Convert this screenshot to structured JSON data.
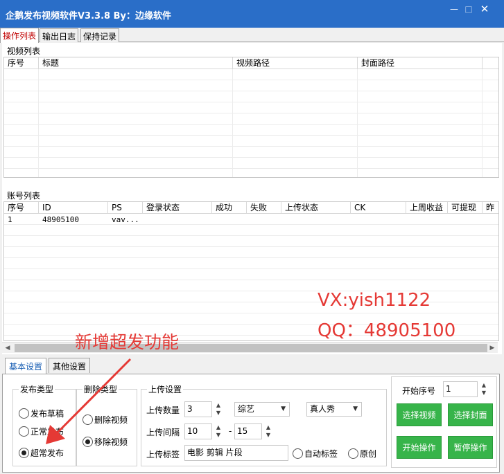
{
  "window": {
    "title": "企鹅发布视频软件V3.3.8 By：边缘软件",
    "min": "—",
    "max": "□",
    "close": "✕"
  },
  "main_tabs": [
    {
      "label": "操作列表"
    },
    {
      "label": "输出日志"
    },
    {
      "label": "保持记录"
    }
  ],
  "video_list": {
    "label": "视频列表",
    "columns": [
      "序号",
      "标题",
      "视频路径",
      "封面路径"
    ]
  },
  "account_list": {
    "label": "账号列表",
    "columns": [
      "序号",
      "ID",
      "PS",
      "登录状态",
      "成功",
      "失败",
      "上传状态",
      "CK",
      "上周收益",
      "可提现",
      "昨"
    ],
    "rows": [
      {
        "index": "1",
        "id": "48905100",
        "ps": "vav..."
      }
    ]
  },
  "overlay": {
    "promo": "新增超发功能",
    "vx": "VX:yish1122",
    "qq": "QQ：48905100"
  },
  "sub_tabs": [
    {
      "label": "基本设置"
    },
    {
      "label": "其他设置"
    }
  ],
  "publish_type": {
    "label": "发布类型",
    "options": [
      "发布草稿",
      "正常发布",
      "超常发布"
    ],
    "selected": 2
  },
  "delete_type": {
    "label": "删除类型",
    "options": [
      "删除视频",
      "移除视频"
    ],
    "selected": 1
  },
  "upload_settings": {
    "label": "上传设置",
    "count_label": "上传数量",
    "count_value": "3",
    "category_value": "综艺",
    "subcategory_value": "真人秀",
    "interval_label": "上传间隔",
    "interval_min": "10",
    "interval_sep": "-",
    "interval_max": "15",
    "tags_label": "上传标签",
    "tags_value": "电影 剪辑 片段",
    "auto_tag_label": "自动标签",
    "original_label": "原创"
  },
  "right_panel": {
    "start_index_label": "开始序号",
    "start_index_value": "1",
    "select_video": "选择视频",
    "select_cover": "选择封面",
    "start_op": "开始操作",
    "pause_op": "暂停操作"
  },
  "colors": {
    "titlebar": "#2a6ec8",
    "accent_red": "#e53935",
    "button_green": "#37b44a"
  }
}
